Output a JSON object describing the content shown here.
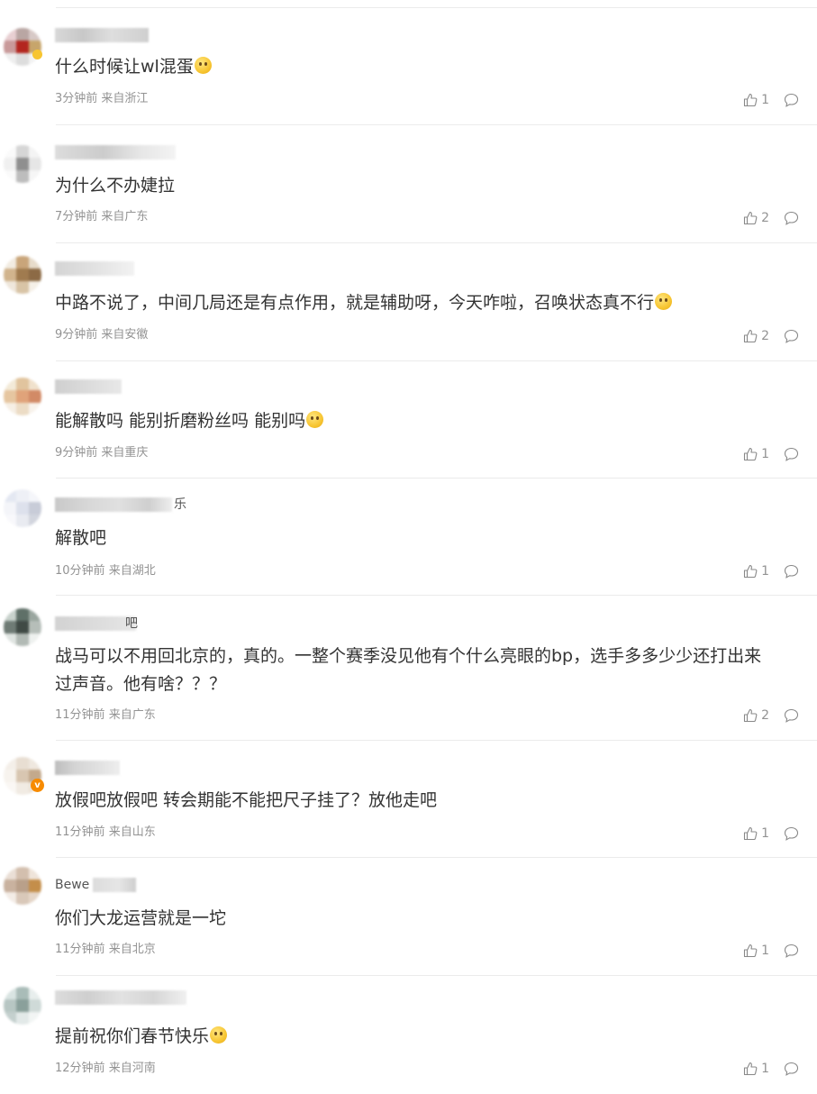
{
  "comments": [
    {
      "text": "什么时候让wl混蛋",
      "emoji": "think-emoji",
      "time": "3分钟前",
      "location": "来自浙江",
      "likes": "1"
    },
    {
      "text": "为什么不办婕拉",
      "emoji": "",
      "time": "7分钟前",
      "location": "来自广东",
      "likes": "2"
    },
    {
      "text": "中路不说了，中间几局还是有点作用，就是辅助呀，今天咋啦，召唤状态真不行",
      "emoji": "laugh-cry-emoji",
      "time": "9分钟前",
      "location": "来自安徽",
      "likes": "2"
    },
    {
      "text": "能解散吗 能别折磨粉丝吗 能别吗",
      "emoji": "smile-emoji",
      "time": "9分钟前",
      "location": "来自重庆",
      "likes": "1"
    },
    {
      "text": "解散吧",
      "emoji": "",
      "time": "10分钟前",
      "location": "来自湖北",
      "likes": "1"
    },
    {
      "text": "战马可以不用回北京的，真的。一整个赛季没见他有个什么亮眼的bp，选手多多少少还打出来过声音。他有啥？？？",
      "emoji": "",
      "time": "11分钟前",
      "location": "来自广东",
      "likes": "2"
    },
    {
      "text": "放假吧放假吧 转会期能不能把尺子挂了？放他走吧",
      "emoji": "",
      "time": "11分钟前",
      "location": "来自山东",
      "likes": "1"
    },
    {
      "text": "你们大龙运营就是一坨",
      "emoji": "",
      "time": "11分钟前",
      "location": "来自北京",
      "likes": "1"
    },
    {
      "text": "提前祝你们春节快乐",
      "emoji": "think-emoji",
      "time": "12分钟前",
      "location": "来自河南",
      "likes": "1"
    }
  ],
  "visible_username_fragments": {
    "4": {
      "tail": "乐"
    },
    "5": {
      "tail": "吧"
    },
    "7": {
      "head": "Bewe"
    }
  },
  "colors": {
    "text": "#333333",
    "meta": "#939393",
    "divider": "#ebebeb",
    "vip_badge": "#f78b00"
  }
}
